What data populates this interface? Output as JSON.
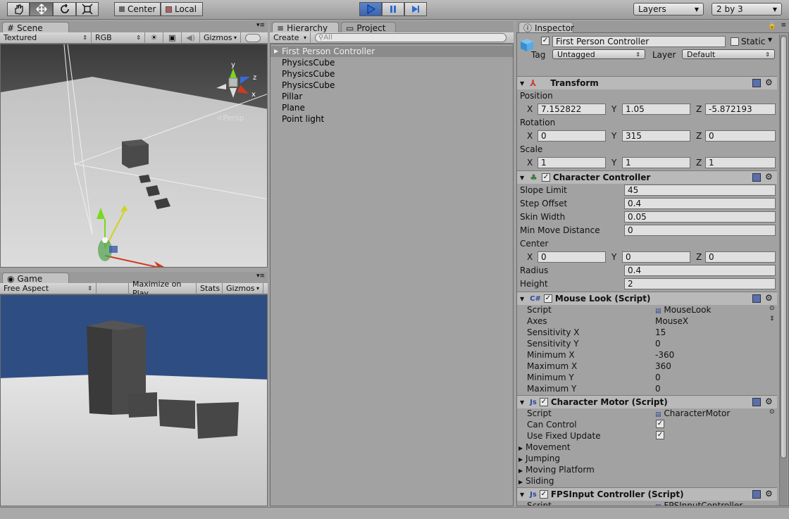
{
  "toolbar": {
    "tools": [
      "hand-icon",
      "move-icon",
      "rotate-icon",
      "scale-icon"
    ],
    "pivot": "Center",
    "space": "Local",
    "layers": "Layers",
    "layout": "2 by 3"
  },
  "scene": {
    "tab": "Scene",
    "render_mode": "Textured",
    "color_mode": "RGB",
    "gizmos": "Gizmos",
    "persp": "Persp",
    "axis_y": "y",
    "axis_z": "z",
    "axis_x": "x"
  },
  "game": {
    "tab": "Game",
    "aspect": "Free Aspect",
    "maximize": "Maximize on Play",
    "stats": "Stats",
    "gizmos": "Gizmos"
  },
  "hierarchy": {
    "tab": "Hierarchy",
    "project_tab": "Project",
    "create": "Create",
    "search_placeholder": "All",
    "items": [
      "First Person Controller",
      "PhysicsCube",
      "PhysicsCube",
      "PhysicsCube",
      "Pillar",
      "Plane",
      "Point light"
    ]
  },
  "inspector": {
    "tab": "Inspector",
    "object_name": "First Person Controller",
    "static_label": "Static",
    "tag_label": "Tag",
    "tag_value": "Untagged",
    "layer_label": "Layer",
    "layer_value": "Default",
    "transform": {
      "title": "Transform",
      "position_label": "Position",
      "position": {
        "x": "7.152822",
        "y": "1.05",
        "z": "-5.872193"
      },
      "rotation_label": "Rotation",
      "rotation": {
        "x": "0",
        "y": "315",
        "z": "0"
      },
      "scale_label": "Scale",
      "scale": {
        "x": "1",
        "y": "1",
        "z": "1"
      }
    },
    "axis": {
      "x": "X",
      "y": "Y",
      "z": "Z"
    },
    "character_controller": {
      "title": "Character Controller",
      "slope_limit_label": "Slope Limit",
      "slope_limit": "45",
      "step_offset_label": "Step Offset",
      "step_offset": "0.4",
      "skin_width_label": "Skin Width",
      "skin_width": "0.05",
      "min_move_label": "Min Move Distance",
      "min_move": "0",
      "center_label": "Center",
      "center": {
        "x": "0",
        "y": "0",
        "z": "0"
      },
      "radius_label": "Radius",
      "radius": "0.4",
      "height_label": "Height",
      "height": "2"
    },
    "mouse_look": {
      "title": "Mouse Look (Script)",
      "script_label": "Script",
      "script": "MouseLook",
      "axes_label": "Axes",
      "axes": "MouseX",
      "sens_x_label": "Sensitivity X",
      "sens_x": "15",
      "sens_y_label": "Sensitivity Y",
      "sens_y": "0",
      "min_x_label": "Minimum X",
      "min_x": "-360",
      "max_x_label": "Maximum X",
      "max_x": "360",
      "min_y_label": "Minimum Y",
      "min_y": "0",
      "max_y_label": "Maximum Y",
      "max_y": "0"
    },
    "character_motor": {
      "title": "Character Motor (Script)",
      "script_label": "Script",
      "script": "CharacterMotor",
      "can_control_label": "Can Control",
      "fixed_update_label": "Use Fixed Update",
      "movement": "Movement",
      "jumping": "Jumping",
      "moving_platform": "Moving Platform",
      "sliding": "Sliding"
    },
    "fps_input": {
      "title": "FPSInput Controller (Script)",
      "script_label": "Script",
      "script": "FPSInputController"
    }
  },
  "colors": {
    "panel_bg": "#a2a2a2",
    "sky": "#2e4e83",
    "selection": "#8b8b8b",
    "play_blue": "#2b6bd1"
  }
}
